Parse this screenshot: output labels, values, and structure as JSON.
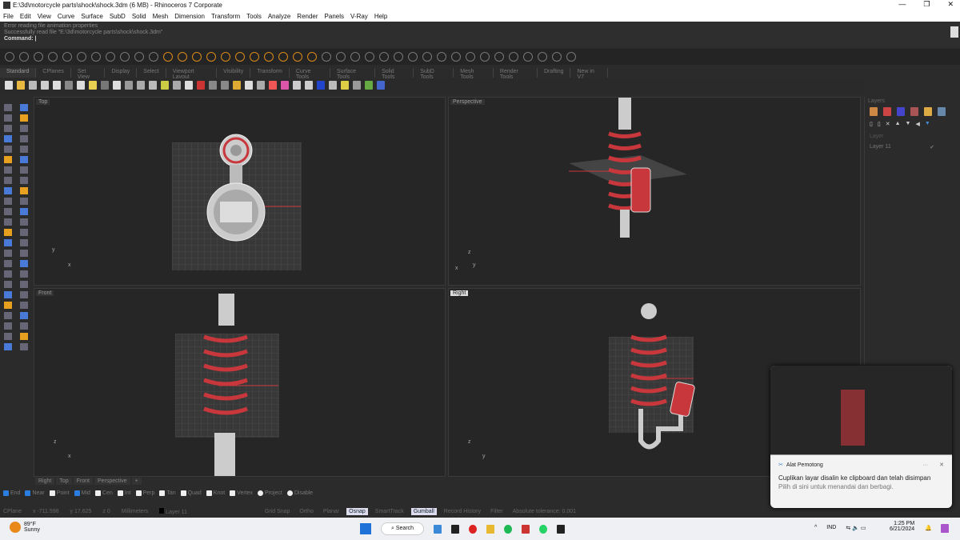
{
  "window": {
    "title": "E:\\3d\\motorcycle parts\\shock\\shock.3dm (6 MB) - Rhinoceros 7 Corporate",
    "controls": [
      "—",
      "❐",
      "✕"
    ]
  },
  "menu": [
    "File",
    "Edit",
    "View",
    "Curve",
    "Surface",
    "SubD",
    "Solid",
    "Mesh",
    "Dimension",
    "Transform",
    "Tools",
    "Analyze",
    "Render",
    "Panels",
    "V-Ray",
    "Help"
  ],
  "command_history": [
    "Error reading file animation properties",
    "Successfully read file \"E:\\3d\\motorcycle parts\\shock\\shock.3dm\""
  ],
  "command_prompt": "Command:",
  "toolbar_tabs": [
    "Standard",
    "CPlanes",
    "Set View",
    "Display",
    "Select",
    "Viewport Layout",
    "Visibility",
    "Transform",
    "Curve Tools",
    "Surface Tools",
    "Solid Tools",
    "SubD Tools",
    "Mesh Tools",
    "Render Tools",
    "Drafting",
    "New in V7"
  ],
  "viewports": {
    "top": "Top",
    "perspective": "Perspective",
    "front": "Front",
    "right": "Right"
  },
  "axes": {
    "x": "x",
    "y": "y",
    "z": "z"
  },
  "right_panel": {
    "header": "Layers",
    "column": "Layer",
    "layer_name": "Layer 11"
  },
  "viewport_tabs": [
    "Right",
    "Top",
    "Front",
    "Perspective",
    "+"
  ],
  "osnaps": [
    {
      "label": "End",
      "on": true
    },
    {
      "label": "Near",
      "on": true
    },
    {
      "label": "Point",
      "on": false
    },
    {
      "label": "Mid",
      "on": true
    },
    {
      "label": "Cen",
      "on": false
    },
    {
      "label": "Int",
      "on": false
    },
    {
      "label": "Perp",
      "on": false
    },
    {
      "label": "Tan",
      "on": false
    },
    {
      "label": "Quad",
      "on": false
    },
    {
      "label": "Knot",
      "on": false
    },
    {
      "label": "Vertex",
      "on": false
    },
    {
      "label": "Project",
      "on": false
    },
    {
      "label": "Disable",
      "on": false
    }
  ],
  "status": {
    "cplane": "CPlane",
    "x": "x -711.598",
    "y": "y 17.625",
    "z": "z 0",
    "units": "Millimeters",
    "layer": "Layer 11",
    "panes": [
      {
        "label": "Grid Snap",
        "on": false
      },
      {
        "label": "Ortho",
        "on": false
      },
      {
        "label": "Planar",
        "on": false
      },
      {
        "label": "Osnap",
        "on": true
      },
      {
        "label": "SmartTrack",
        "on": false
      },
      {
        "label": "Gumball",
        "on": true
      },
      {
        "label": "Record History",
        "on": false
      },
      {
        "label": "Filter",
        "on": false
      },
      {
        "label": "Absolute tolerance: 0.001",
        "on": false
      }
    ]
  },
  "notification": {
    "app": "Alat Pemotong",
    "title": "Cuplikan layar disalin ke clipboard dan telah disimpan",
    "body": "Pilih di sini untuk menandai dan berbagi.",
    "more": "···",
    "close": "✕"
  },
  "taskbar": {
    "weather_temp": "89°F",
    "weather_desc": "Sunny",
    "search": "Search",
    "language": "IND",
    "time": "1:25 PM",
    "date": "6/21/2024"
  },
  "colors": {
    "spring": "#c8373c",
    "accent": "#2a7ee0"
  }
}
